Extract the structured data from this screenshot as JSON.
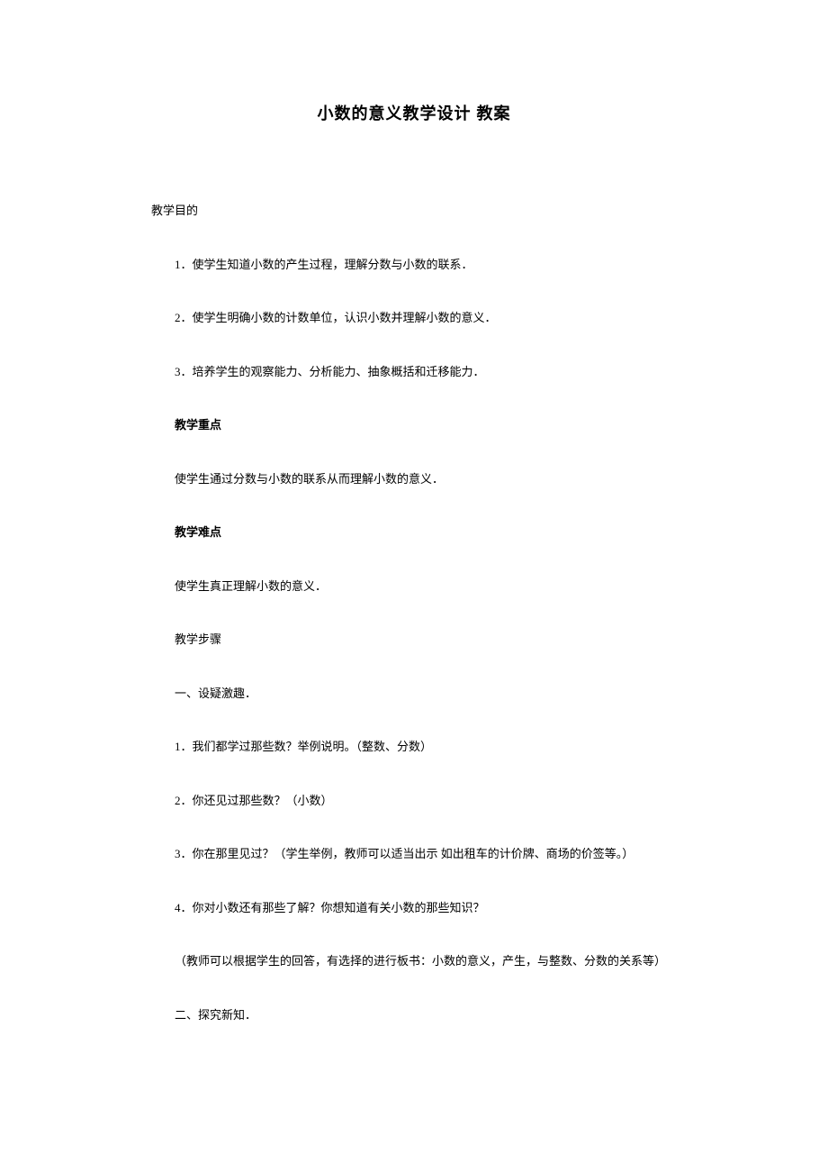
{
  "title": "小数的意义教学设计  教案",
  "lines": {
    "l0": "教学目的",
    "l1": "1．使学生知道小数的产生过程，理解分数与小数的联系．",
    "l2": "2．使学生明确小数的计数单位，认识小数并理解小数的意义．",
    "l3": "3．培养学生的观察能力、分析能力、抽象概括和迁移能力．",
    "l4": "教学重点",
    "l5": "使学生通过分数与小数的联系从而理解小数的意义．",
    "l6": "教学难点",
    "l7": "使学生真正理解小数的意义．",
    "l8": "教学步骤",
    "l9": "一、设疑激趣．",
    "l10": "1．我们都学过那些数？举例说明。（整数、分数）",
    "l11": "2．你还见过那些数？（小数）",
    "l12": "3．你在那里见过？（学生举例，教师可以适当出示 如出租车的计价牌、商场的价签等。）",
    "l13": "4．你对小数还有那些了解？你想知道有关小数的那些知识？",
    "l14": "（教师可以根据学生的回答，有选择的进行板书：小数的意义，产生，与整数、分数的关系等）",
    "l15": "二、探究新知．"
  }
}
